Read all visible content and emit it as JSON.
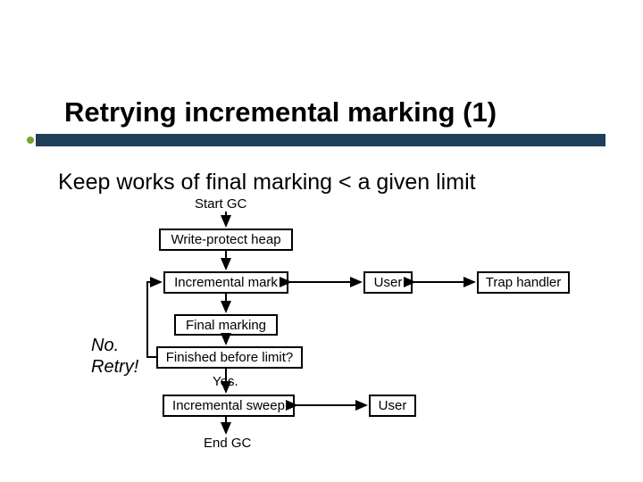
{
  "title": "Retrying incremental marking (1)",
  "subhead": "Keep works of final marking < a given limit",
  "labels": {
    "start": "Start GC",
    "yes": "Yes.",
    "end": "End GC"
  },
  "boxes": {
    "write_protect": "Write-protect heap",
    "inc_mark": "Incremental mark",
    "user1": "User",
    "trap": "Trap handler",
    "final_mark": "Final marking",
    "decision": "Finished before limit?",
    "inc_sweep": "Incremental sweep",
    "user2": "User"
  },
  "retry": {
    "no": "No.",
    "retry": "Retry!"
  }
}
